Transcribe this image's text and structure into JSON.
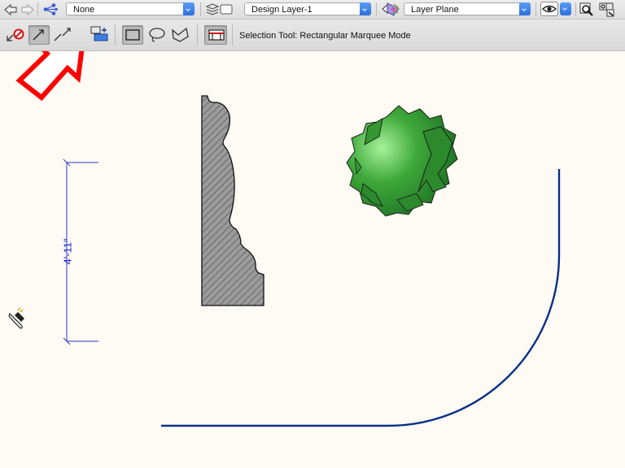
{
  "toolbar_top": {
    "class_select": {
      "value": "None"
    },
    "layer_select": {
      "value": "Design Layer-1"
    },
    "plane_select": {
      "value": "Layer Plane"
    }
  },
  "toolbar_mode": {
    "status_text": "Selection Tool: Rectangular Marquee Mode"
  },
  "drawing": {
    "dimension_label": "4'-11\""
  },
  "colors": {
    "callout_arrow": "#ff0000",
    "dimension": "#1f27c9",
    "wall_line": "#0a2f8a",
    "foliage": "#3ea83a",
    "profile_fill": "#9b9b9b"
  },
  "icons": {
    "back": "arrow-left-icon",
    "forward": "arrow-right-icon",
    "classes": "class-hierarchy-icon",
    "layers": "layers-icon",
    "plane": "plane-icon",
    "visibility": "eye-icon",
    "zoom": "magnify-icon",
    "navigation": "navigation-icon"
  }
}
